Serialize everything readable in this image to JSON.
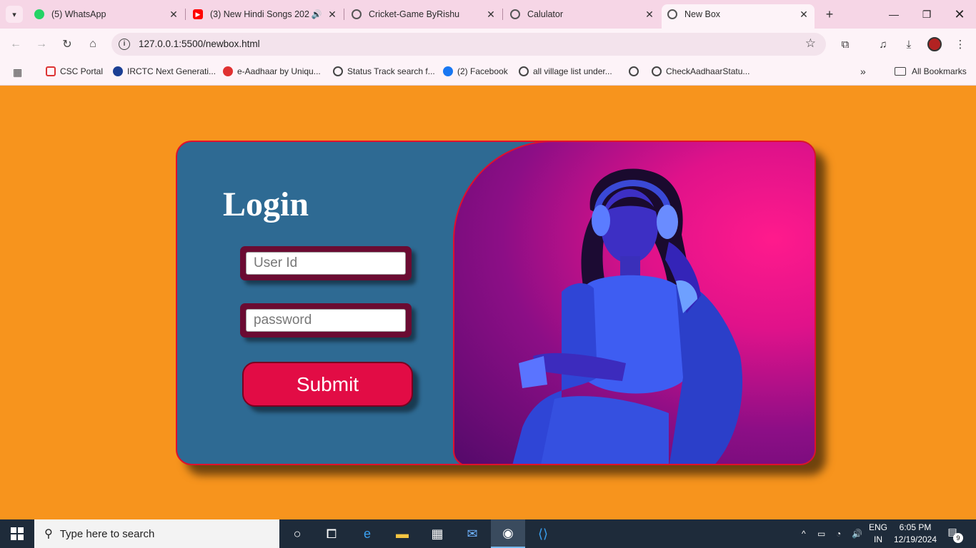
{
  "browser": {
    "tabs": [
      {
        "title": "(5) WhatsApp",
        "icon": "whatsapp-icon"
      },
      {
        "title": "(3) New Hindi Songs 202",
        "icon": "youtube-icon",
        "audio": true
      },
      {
        "title": "Cricket-Game ByRishu",
        "icon": "globe-icon"
      },
      {
        "title": "Calulator",
        "icon": "globe-icon"
      },
      {
        "title": "New Box",
        "icon": "globe-icon",
        "active": true
      }
    ],
    "url": "127.0.0.1:5500/newbox.html",
    "bookmarks": [
      {
        "label": "CSC Portal",
        "icon": "csc-icon"
      },
      {
        "label": "IRCTC Next Generati...",
        "icon": "irctc-icon"
      },
      {
        "label": "e-Aadhaar by Uniqu...",
        "icon": "aadhaar-icon"
      },
      {
        "label": "Status Track search f...",
        "icon": "globe-icon"
      },
      {
        "label": "(2) Facebook",
        "icon": "facebook-icon"
      },
      {
        "label": "all village list under...",
        "icon": "globe-icon"
      },
      {
        "label": "",
        "icon": "globe-icon"
      },
      {
        "label": "CheckAadhaarStatu...",
        "icon": "globe-icon"
      }
    ],
    "all_bookmarks_label": "All Bookmarks"
  },
  "page": {
    "login_title": "Login",
    "userid_placeholder": "User Id",
    "password_placeholder": "password",
    "submit_label": "Submit",
    "colors": {
      "background": "#f7941d",
      "card": "#2e6a93",
      "border": "#e0102c",
      "field_frame": "#6b0b32",
      "button": "#e20c45"
    }
  },
  "taskbar": {
    "search_placeholder": "Type here to search",
    "language": "ENG",
    "region": "IN",
    "time": "6:05 PM",
    "date": "12/19/2024",
    "notification_count": "9"
  }
}
